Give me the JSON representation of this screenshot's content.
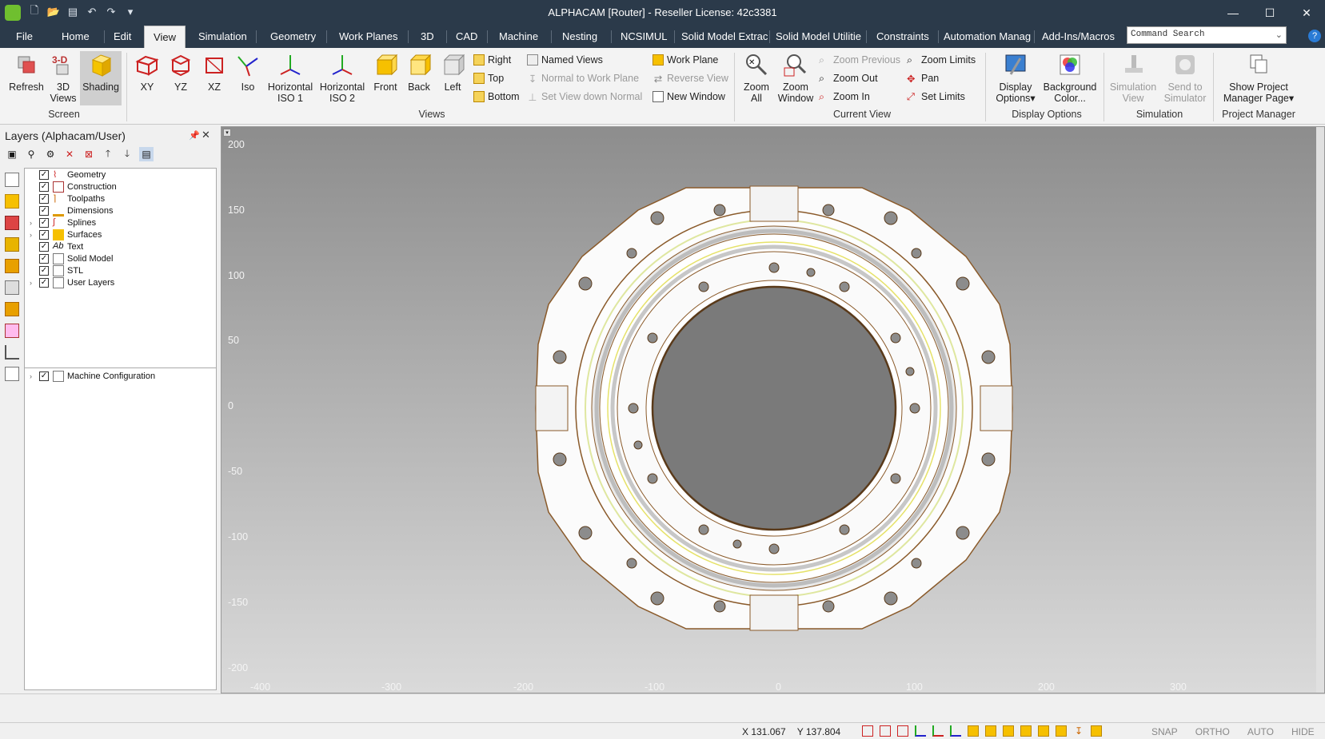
{
  "window": {
    "title": "ALPHACAM [Router] - Reseller License: 42c3381",
    "controls": {
      "minimize": "—",
      "maximize": "☐",
      "close": "✕"
    }
  },
  "quick_access": {
    "new_icon": "new-file-icon",
    "open_icon": "folder-open-icon",
    "save_icon": "save-icon",
    "undo_icon": "undo-icon",
    "redo_icon": "redo-icon",
    "more_icon": "chevron-down-icon"
  },
  "tabs": [
    {
      "label": "File"
    },
    {
      "label": "Home"
    },
    {
      "label": "Edit"
    },
    {
      "label": "View",
      "active": true
    },
    {
      "label": "Simulation"
    },
    {
      "label": "Geometry"
    },
    {
      "label": "Work Planes"
    },
    {
      "label": "3D"
    },
    {
      "label": "CAD"
    },
    {
      "label": "Machine"
    },
    {
      "label": "Nesting"
    },
    {
      "label": "NCSIMUL"
    },
    {
      "label": "Solid Model Extrac"
    },
    {
      "label": "Solid Model Utilitie"
    },
    {
      "label": "Constraints"
    },
    {
      "label": "Automation Manag"
    },
    {
      "label": "Add-Ins/Macros"
    }
  ],
  "command_search": {
    "placeholder": "Command Search"
  },
  "ribbon": {
    "screen": {
      "group": "Screen",
      "refresh": "Refresh",
      "views3d": "3D Views",
      "shading": "Shading"
    },
    "views": {
      "group": "Views",
      "xy": "XY",
      "yz": "YZ",
      "xz": "XZ",
      "iso": "Iso",
      "horiz1": "Horizontal ISO 1",
      "horiz2": "Horizontal ISO 2",
      "front": "Front",
      "back": "Back",
      "left": "Left",
      "right": "Right",
      "top": "Top",
      "bottom": "Bottom",
      "named_views": "Named Views",
      "normal_wp": "Normal to Work Plane",
      "set_down_normal": "Set View down Normal",
      "work_plane": "Work Plane",
      "reverse_view": "Reverse View",
      "new_window": "New Window"
    },
    "current_view": {
      "group": "Current View",
      "zoom_all": "Zoom All",
      "zoom_window": "Zoom Window",
      "zoom_previous": "Zoom Previous",
      "zoom_out": "Zoom Out",
      "zoom_in": "Zoom In",
      "zoom_limits": "Zoom Limits",
      "pan": "Pan",
      "set_limits": "Set Limits"
    },
    "display": {
      "group": "Display Options",
      "display_options": "Display Options",
      "background_color": "Background Color..."
    },
    "simulation": {
      "group": "Simulation",
      "sim_view": "Simulation View",
      "send_sim": "Send to Simulator"
    },
    "project": {
      "group": "Project Manager",
      "show_page": "Show Project Manager Page"
    }
  },
  "layers_panel": {
    "title": "Layers (Alphacam/User)",
    "layers": [
      {
        "label": "Geometry",
        "checked": true,
        "expandable": false
      },
      {
        "label": "Construction",
        "checked": true,
        "expandable": false
      },
      {
        "label": "Toolpaths",
        "checked": true,
        "expandable": false
      },
      {
        "label": "Dimensions",
        "checked": true,
        "expandable": false
      },
      {
        "label": "Splines",
        "checked": true,
        "expandable": true
      },
      {
        "label": "Surfaces",
        "checked": true,
        "expandable": true
      },
      {
        "label": "Text",
        "checked": true,
        "expandable": false
      },
      {
        "label": "Solid Model",
        "checked": true,
        "expandable": false
      },
      {
        "label": "STL",
        "checked": true,
        "expandable": false
      },
      {
        "label": "User Layers",
        "checked": true,
        "expandable": true
      }
    ],
    "machine_config": "Machine Configuration"
  },
  "viewport": {
    "y_ticks": [
      "200",
      "150",
      "100",
      "50",
      "0",
      "-50",
      "-100",
      "-150",
      "-200"
    ],
    "x_ticks": [
      "-400",
      "-300",
      "-200",
      "-100",
      "0",
      "100",
      "200",
      "300"
    ]
  },
  "status": {
    "x_label": "X 131.067",
    "y_label": "Y 137.804",
    "modes": [
      "SNAP",
      "ORTHO",
      "AUTO",
      "HIDE"
    ]
  }
}
